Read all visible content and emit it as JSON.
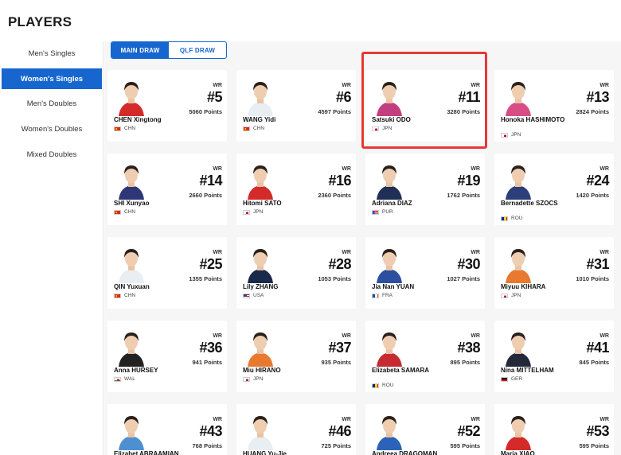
{
  "page": {
    "title": "PLAYERS"
  },
  "sidebar": {
    "items": [
      {
        "label": "Men's Singles",
        "active": false
      },
      {
        "label": "Women's Singles",
        "active": true
      },
      {
        "label": "Men's Doubles",
        "active": false
      },
      {
        "label": "Women's Doubles",
        "active": false
      },
      {
        "label": "Mixed Doubles",
        "active": false
      }
    ]
  },
  "draw_tabs": [
    {
      "label": "MAIN DRAW",
      "active": true
    },
    {
      "label": "QLF DRAW",
      "active": false
    }
  ],
  "wr_label": "WR",
  "players": [
    {
      "name": "CHEN Xingtong",
      "rank": "#5",
      "points": "5060 Points",
      "country": "CHN",
      "flag": "chn",
      "shirt": "#d42a2a"
    },
    {
      "name": "WANG Yidi",
      "rank": "#6",
      "points": "4597 Points",
      "country": "CHN",
      "flag": "chn",
      "shirt": "#e9eef2"
    },
    {
      "name": "Satsuki ODO",
      "rank": "#11",
      "points": "3280 Points",
      "country": "JPN",
      "flag": "jpn",
      "shirt": "#c23f7f"
    },
    {
      "name": "Honoka HASHIMOTO",
      "rank": "#13",
      "points": "2824 Points",
      "country": "JPN",
      "flag": "jpn",
      "shirt": "#d94d86"
    },
    {
      "name": "SHI Xunyao",
      "rank": "#14",
      "points": "2660 Points",
      "country": "CHN",
      "flag": "chn",
      "shirt": "#2d3778"
    },
    {
      "name": "Hitomi SATO",
      "rank": "#16",
      "points": "2360 Points",
      "country": "JPN",
      "flag": "jpn",
      "shirt": "#d42a2a"
    },
    {
      "name": "Adriana DIAZ",
      "rank": "#19",
      "points": "1762 Points",
      "country": "PUR",
      "flag": "pur",
      "shirt": "#1f2f56"
    },
    {
      "name": "Bernadette SZOCS",
      "rank": "#24",
      "points": "1420 Points",
      "country": "ROU",
      "flag": "rou",
      "shirt": "#2c3f7a"
    },
    {
      "name": "QIN Yuxuan",
      "rank": "#25",
      "points": "1355 Points",
      "country": "CHN",
      "flag": "chn",
      "shirt": "#e9eef2"
    },
    {
      "name": "Lily ZHANG",
      "rank": "#28",
      "points": "1053 Points",
      "country": "USA",
      "flag": "usa",
      "shirt": "#1a2a4a"
    },
    {
      "name": "Jia Nan YUAN",
      "rank": "#30",
      "points": "1027 Points",
      "country": "FRA",
      "flag": "fra",
      "shirt": "#2c4fa0"
    },
    {
      "name": "Miyuu KIHARA",
      "rank": "#31",
      "points": "1010 Points",
      "country": "JPN",
      "flag": "jpn",
      "shirt": "#e8792f"
    },
    {
      "name": "Anna HURSEY",
      "rank": "#36",
      "points": "941 Points",
      "country": "WAL",
      "flag": "wal",
      "shirt": "#222222"
    },
    {
      "name": "Miu HIRANO",
      "rank": "#37",
      "points": "935 Points",
      "country": "JPN",
      "flag": "jpn",
      "shirt": "#e8792f"
    },
    {
      "name": "Elizabeta SAMARA",
      "rank": "#38",
      "points": "895 Points",
      "country": "ROU",
      "flag": "rou",
      "shirt": "#c62b32"
    },
    {
      "name": "Nina MITTELHAM",
      "rank": "#41",
      "points": "845 Points",
      "country": "GER",
      "flag": "ger",
      "shirt": "#222a3a"
    },
    {
      "name": "Elizabet ABRAAMIAN",
      "rank": "#43",
      "points": "768 Points",
      "country": "",
      "flag": "none",
      "shirt": "#4d8fd0"
    },
    {
      "name": "HUANG Yu-Jie",
      "rank": "#46",
      "points": "725 Points",
      "country": "",
      "flag": "none",
      "shirt": "#e9eef2"
    },
    {
      "name": "Andreea DRAGOMAN",
      "rank": "#52",
      "points": "595 Points",
      "country": "",
      "flag": "none",
      "shirt": "#2c63b8"
    },
    {
      "name": "Maria XIAO",
      "rank": "#53",
      "points": "595 Points",
      "country": "",
      "flag": "none",
      "shirt": "#d42a2a"
    }
  ]
}
